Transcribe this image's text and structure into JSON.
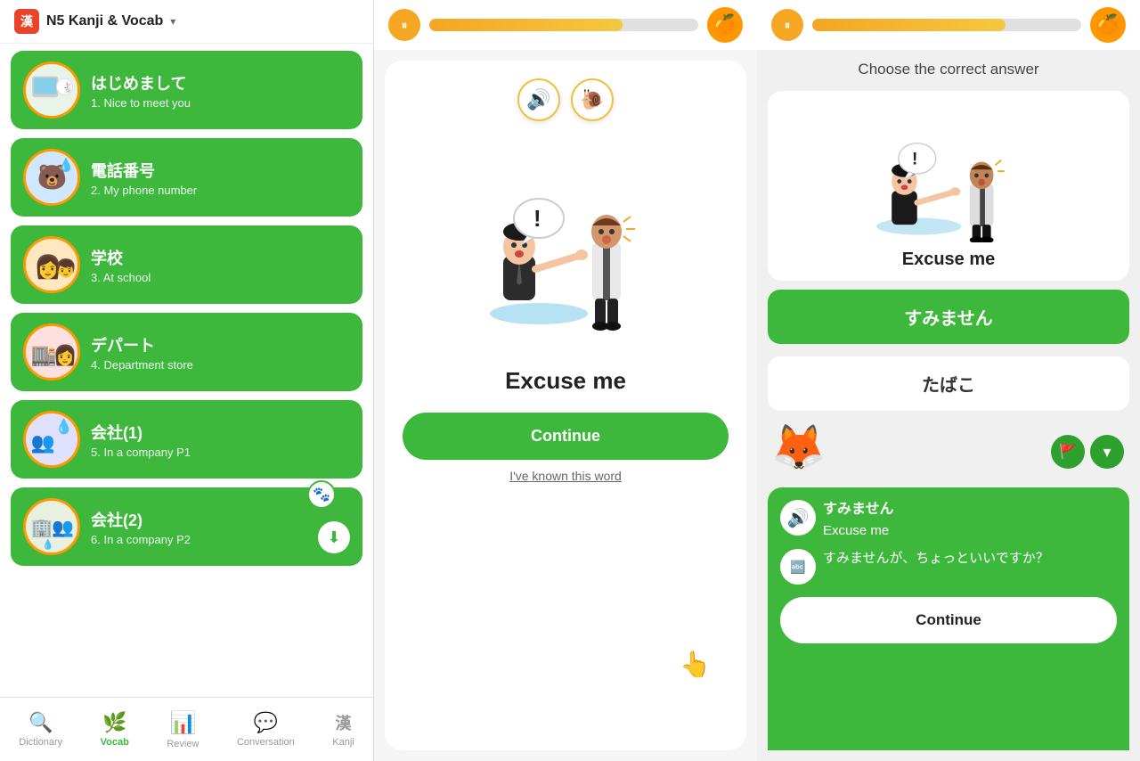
{
  "app": {
    "title": "N5 Kanji & Vocab",
    "header_icon": "漢",
    "chevron": "▾"
  },
  "lessons": [
    {
      "id": 1,
      "title": "はじめまして",
      "subtitle": "1. Nice to meet you",
      "emoji": "🐇",
      "bg": "window"
    },
    {
      "id": 2,
      "title": "電話番号",
      "subtitle": "2. My phone number",
      "emoji": "🐻",
      "bg": "rain"
    },
    {
      "id": 3,
      "title": "学校",
      "subtitle": "3. At school",
      "emoji": "👩",
      "bg": "school"
    },
    {
      "id": 4,
      "title": "デパート",
      "subtitle": "4.  Department store",
      "emoji": "🏬",
      "bg": "store"
    },
    {
      "id": 5,
      "title": "会社(1)",
      "subtitle": "5. In a company P1",
      "emoji": "👥",
      "bg": "company"
    },
    {
      "id": 6,
      "title": "会社(2)",
      "subtitle": "6. In a company P2",
      "emoji": "🏢",
      "bg": "company2",
      "has_badge": true
    }
  ],
  "nav": {
    "items": [
      {
        "id": "dictionary",
        "label": "Dictionary",
        "icon": "🔍",
        "active": false
      },
      {
        "id": "vocab",
        "label": "Vocab",
        "icon": "🌿",
        "active": true
      },
      {
        "id": "review",
        "label": "Review",
        "icon": "📊",
        "active": false
      },
      {
        "id": "conversation",
        "label": "Conversation",
        "icon": "💬",
        "active": false
      },
      {
        "id": "kanji",
        "label": "Kanji",
        "icon": "漢",
        "active": false
      }
    ]
  },
  "middle": {
    "progress_percent": 72,
    "card_word": "Excuse me",
    "continue_label": "Continue",
    "known_label": "I've known this word",
    "sound_icon": "🔊",
    "slow_icon": "🐌",
    "orange_icon": "🍊"
  },
  "right": {
    "progress_percent": 72,
    "choose_text": "Choose the correct answer",
    "card_word": "Excuse me",
    "answers": [
      {
        "id": "a1",
        "text": "すみません",
        "selected": true
      },
      {
        "id": "a2",
        "text": "たばこ",
        "selected": false
      }
    ],
    "chat": {
      "messages": [
        {
          "avatar_icon": "🔊",
          "line1": "すみません",
          "line2": "Excuse me"
        },
        {
          "avatar_icon": "🔤",
          "line1": "すみませんが、ちょっといいですか？",
          "line2": ""
        }
      ]
    },
    "continue_label": "Continue",
    "orange_icon": "🍊",
    "flag_icon": "🚩",
    "chevron_icon": "▾"
  }
}
